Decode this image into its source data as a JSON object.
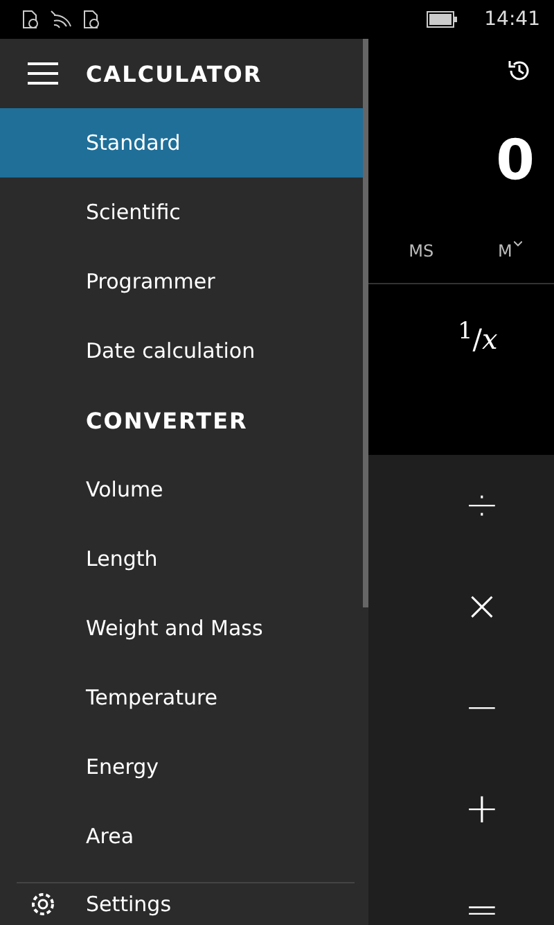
{
  "status_bar": {
    "time": "14:41"
  },
  "drawer": {
    "sections": [
      {
        "title": "CALCULATOR",
        "items": [
          {
            "label": "Standard",
            "selected": true
          },
          {
            "label": "Scientific",
            "selected": false
          },
          {
            "label": "Programmer",
            "selected": false
          },
          {
            "label": "Date calculation",
            "selected": false
          }
        ]
      },
      {
        "title": "CONVERTER",
        "items": [
          {
            "label": "Volume",
            "selected": false
          },
          {
            "label": "Length",
            "selected": false
          },
          {
            "label": "Weight and Mass",
            "selected": false
          },
          {
            "label": "Temperature",
            "selected": false
          },
          {
            "label": "Energy",
            "selected": false
          },
          {
            "label": "Area",
            "selected": false
          }
        ]
      }
    ],
    "settings": "Settings"
  },
  "calculator": {
    "display": "0",
    "memory_buttons": [
      "MS",
      "M"
    ],
    "reciprocal": "$^{1}$/*x*",
    "operators": [
      "÷",
      "×",
      "−",
      "+",
      "="
    ]
  }
}
